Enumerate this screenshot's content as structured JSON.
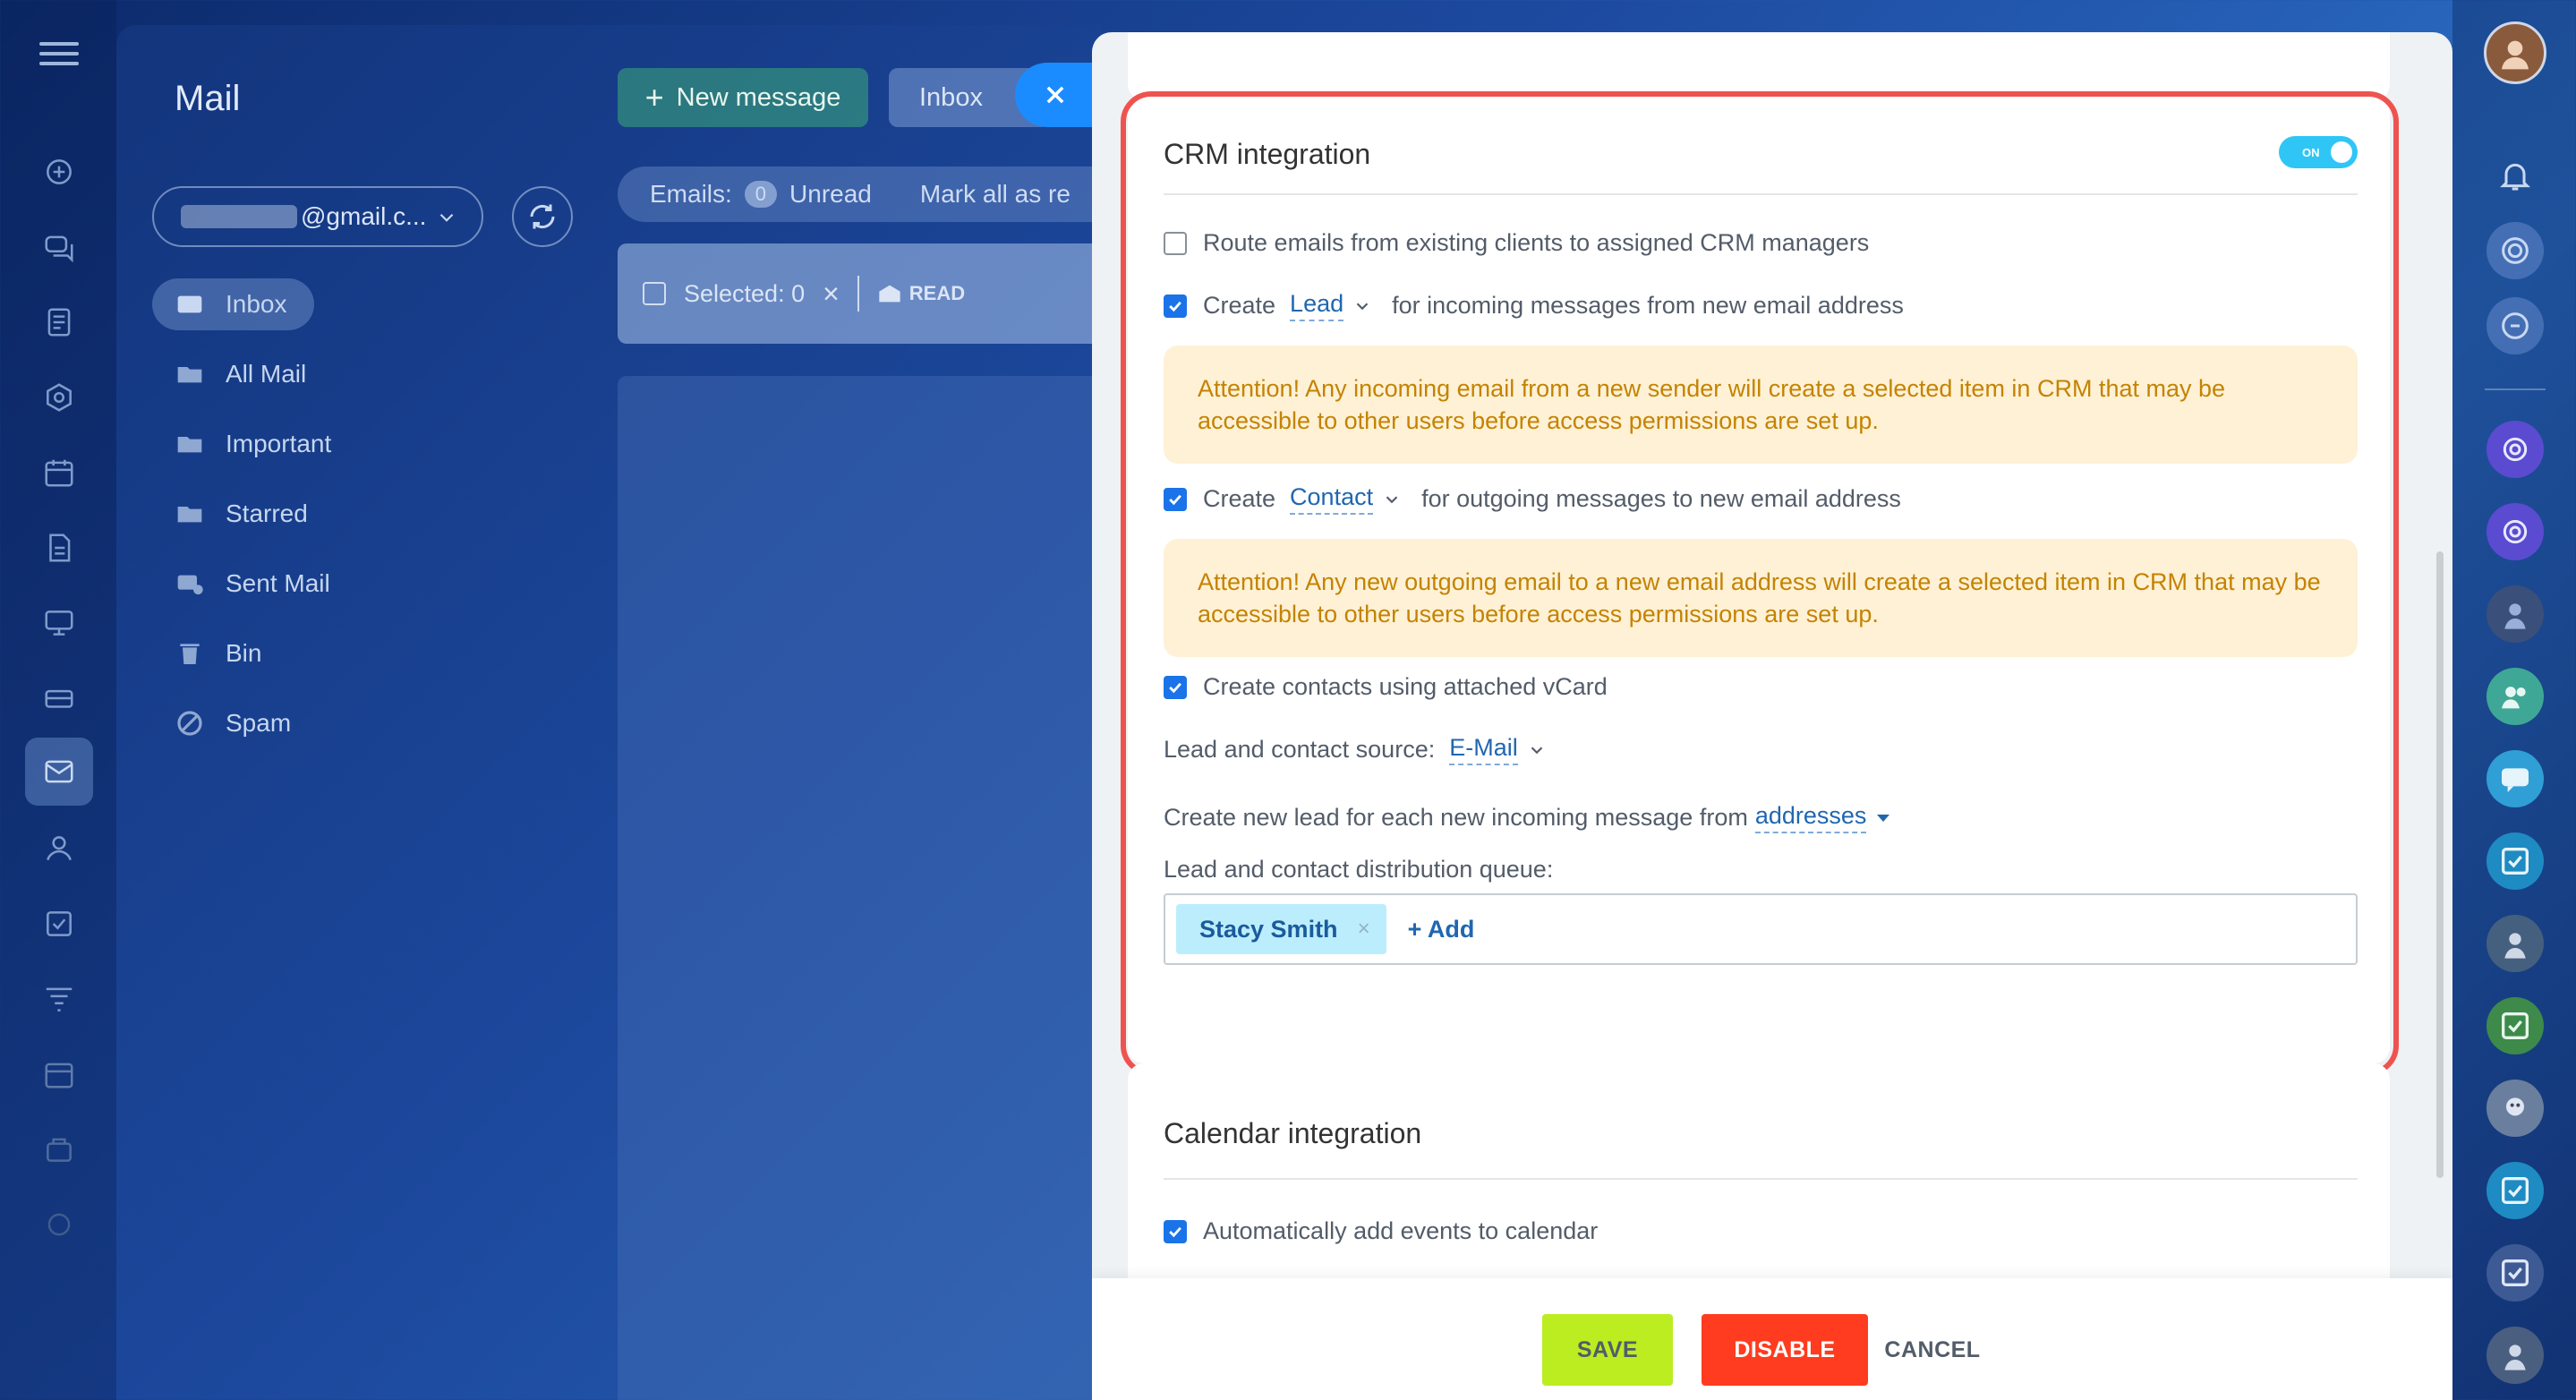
{
  "mail": {
    "title": "Mail",
    "account": "@gmail.c...",
    "new_message": "New message",
    "inbox_tab": "Inbox",
    "emails_label": "Emails:",
    "emails_count": "0",
    "unread_label": "Unread",
    "mark_all": "Mark all as re",
    "selected_label": "Selected: 0",
    "read_label": "READ",
    "folders": [
      {
        "label": "Inbox",
        "icon": "inbox-icon"
      },
      {
        "label": "All Mail",
        "icon": "folder-icon"
      },
      {
        "label": "Important",
        "icon": "folder-icon"
      },
      {
        "label": "Starred",
        "icon": "folder-icon"
      },
      {
        "label": "Sent Mail",
        "icon": "sent-icon"
      },
      {
        "label": "Bin",
        "icon": "trash-icon"
      },
      {
        "label": "Spam",
        "icon": "spam-icon"
      }
    ]
  },
  "crm": {
    "title": "CRM integration",
    "toggle_label": "ON",
    "route_label": "Route emails from existing clients to assigned CRM managers",
    "create_word": "Create",
    "lead_value": "Lead",
    "incoming_suffix": "for incoming messages from new email address",
    "attention_incoming": "Attention! Any incoming email from a new sender will create a selected item in CRM that may be accessible to other users before access permissions are set up.",
    "contact_value": "Contact",
    "outgoing_suffix": "for outgoing messages to new email address",
    "attention_outgoing": "Attention! Any new outgoing email to a new email address will create a selected item in CRM that may be accessible to other users before access permissions are set up.",
    "vcard_label": "Create contacts using attached vCard",
    "source_label": "Lead and contact source:",
    "source_value": "E-Mail",
    "new_lead_label": "Create new lead for each new incoming message from",
    "new_lead_value": "addresses",
    "queue_label": "Lead and contact distribution queue:",
    "queue_user": "Stacy Smith",
    "queue_remove": "×",
    "add_label": "+ Add"
  },
  "calendar": {
    "title": "Calendar integration",
    "auto_add_label": "Automatically add events to calendar"
  },
  "footer": {
    "save": "SAVE",
    "disable": "DISABLE",
    "cancel": "CANCEL"
  },
  "colors": {
    "accent": "#1a73e8",
    "toggle": "#2fc6f6",
    "save": "#bbed21",
    "disable": "#ff3c1f",
    "highlight_outline": "#ef5350",
    "attention_bg": "#fff1d6",
    "attention_text": "#c48300"
  }
}
